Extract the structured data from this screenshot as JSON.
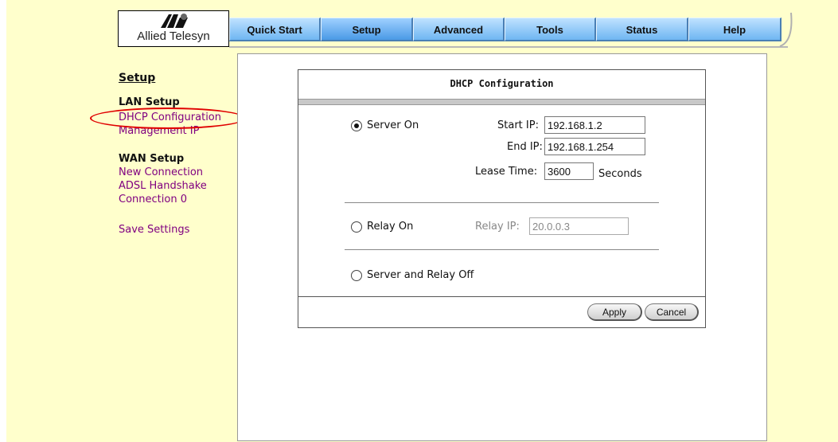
{
  "brand": {
    "name": "Allied Telesyn",
    "logo_icon": "allied-telesyn-logo-icon"
  },
  "tabs": [
    {
      "label": "Quick Start",
      "active": false
    },
    {
      "label": "Setup",
      "active": true
    },
    {
      "label": "Advanced",
      "active": false
    },
    {
      "label": "Tools",
      "active": false
    },
    {
      "label": "Status",
      "active": false
    },
    {
      "label": "Help",
      "active": false
    }
  ],
  "sidebar": {
    "title": "Setup",
    "lan_heading": "LAN Setup",
    "lan_items": [
      "DHCP Configuration",
      "Management IP"
    ],
    "wan_heading": "WAN Setup",
    "wan_items": [
      "New Connection",
      "ADSL Handshake",
      "Connection 0"
    ],
    "save": "Save Settings"
  },
  "dhcp": {
    "title": "DHCP Configuration",
    "server_on": "Server On",
    "start_ip_label": "Start IP:",
    "start_ip": "192.168.1.2",
    "end_ip_label": "End IP:",
    "end_ip": "192.168.1.254",
    "lease_label": "Lease Time:",
    "lease_value": "3600",
    "lease_unit": "Seconds",
    "relay_on": "Relay On",
    "relay_ip_label": "Relay IP:",
    "relay_ip": "20.0.0.3",
    "off": "Server and Relay Off",
    "selected": "server_on",
    "apply": "Apply",
    "cancel": "Cancel"
  },
  "colors": {
    "background": "#ffffcc",
    "tab": "#6fb6f2",
    "link": "#800080",
    "highlight": "#e00000"
  }
}
